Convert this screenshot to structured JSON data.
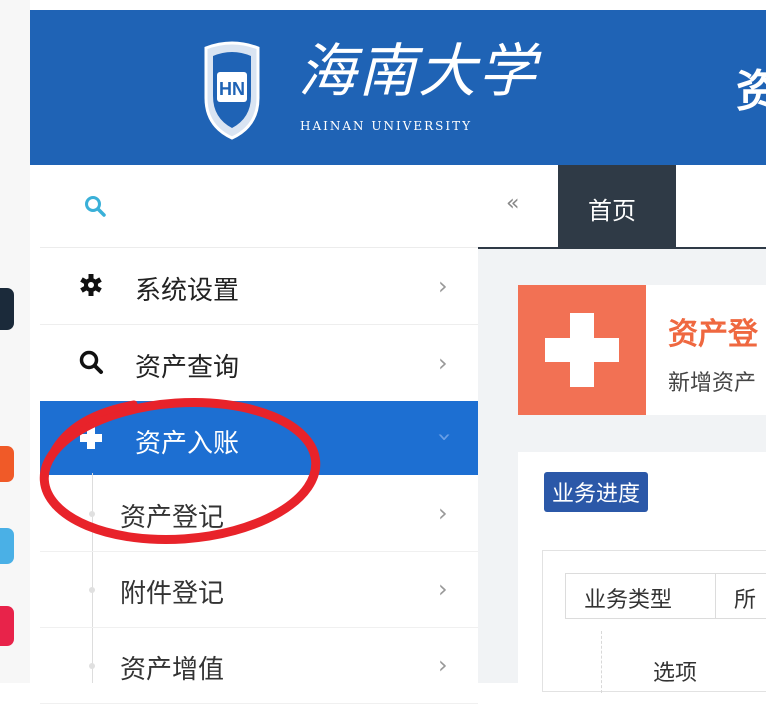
{
  "header": {
    "logo_text": "HN",
    "university_cn": "海南大学",
    "university_en": "HAINAN UNIVERSITY",
    "system_title": "资",
    "background_color": "#1f63b5"
  },
  "sidebar": {
    "search_icon": "search-icon",
    "menu": [
      {
        "label": "系统设置",
        "icon": "gear-icon",
        "chevron": "›"
      },
      {
        "label": "资产查询",
        "icon": "search-icon",
        "chevron": "›"
      },
      {
        "label": "资产入账",
        "icon": "plus-icon",
        "chevron": "›",
        "active": true
      }
    ],
    "submenu": [
      {
        "label": "资产登记",
        "chevron": "›"
      },
      {
        "label": "附件登记",
        "chevron": "›"
      },
      {
        "label": "资产增值",
        "chevron": "›"
      }
    ],
    "active_color": "#1d6fd2"
  },
  "tabs": {
    "back_icon": "«",
    "home_label": "首页"
  },
  "action_card": {
    "title": "资产登",
    "subtitle": "新增资产",
    "accent_color": "#f27154"
  },
  "progress": {
    "badge": "业务进度",
    "table_headers": [
      "业务类型",
      "所"
    ],
    "option_label": "选项"
  },
  "annotation": {
    "circle_color": "#e8232a"
  }
}
